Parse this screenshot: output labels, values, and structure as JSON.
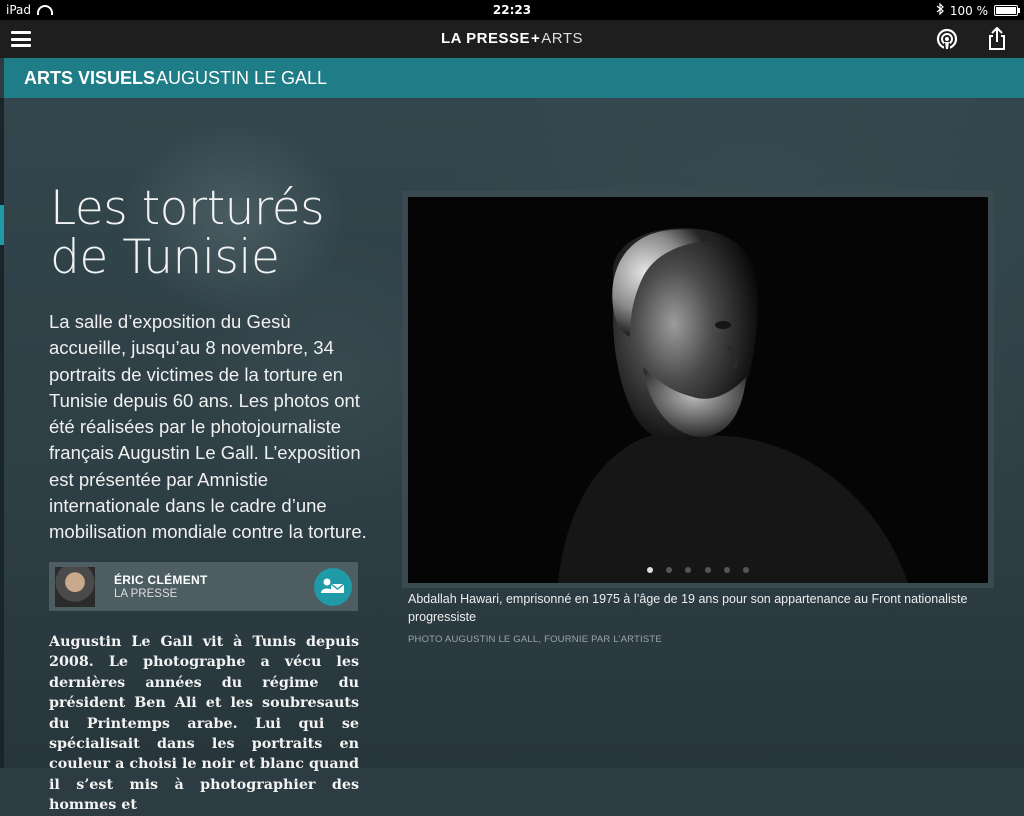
{
  "status_bar": {
    "device": "iPad",
    "time": "22:23",
    "battery": "100 %"
  },
  "nav": {
    "brand_main": "LA PRESSE",
    "brand_plus": "+",
    "brand_section": "ARTS"
  },
  "section_bar": {
    "category": "ARTS VISUELS",
    "subject": "AUGUSTIN LE GALL"
  },
  "article": {
    "title_line1": "Les torturés",
    "title_line2": "de Tunisie",
    "lead": "La salle d’exposition du Gesù accueille, jusqu’au 8 novembre, 34 portraits de victimes de la torture en Tunisie depuis 60 ans. Les photos ont été réalisées par le photojournaliste français Augustin Le Gall. L’exposition est présentée par Amnistie internationale dans le cadre d’une mobilisation mondiale contre la torture.",
    "author_name": "ÉRIC CLÉMENT",
    "author_org": "LA PRESSE",
    "body": "Augustin Le Gall vit à Tunis depuis 2008. Le photographe a vécu les dernières années du régime du président Ben Ali et les soubresauts du Printemps arabe. Lui qui se spécialisait dans les portraits en couleur a choisi le noir et blanc quand il s’est mis à photographier des hommes et"
  },
  "photo": {
    "caption": "Abdallah Hawari, emprisonné en 1975 à l’âge de 19 ans pour son appartenance au Front nationaliste progressiste",
    "credit": "PHOTO AUGUSTIN LE GALL, FOURNIE PAR L’ARTISTE",
    "slide_count": 6,
    "active_slide": 1
  },
  "colors": {
    "accent": "#1f7d87",
    "accent_light": "#1f9aa6"
  },
  "icons": [
    "hamburger-icon",
    "podcast-icon",
    "share-icon",
    "contact-icon",
    "wifi-icon",
    "bluetooth-icon",
    "battery-icon"
  ]
}
